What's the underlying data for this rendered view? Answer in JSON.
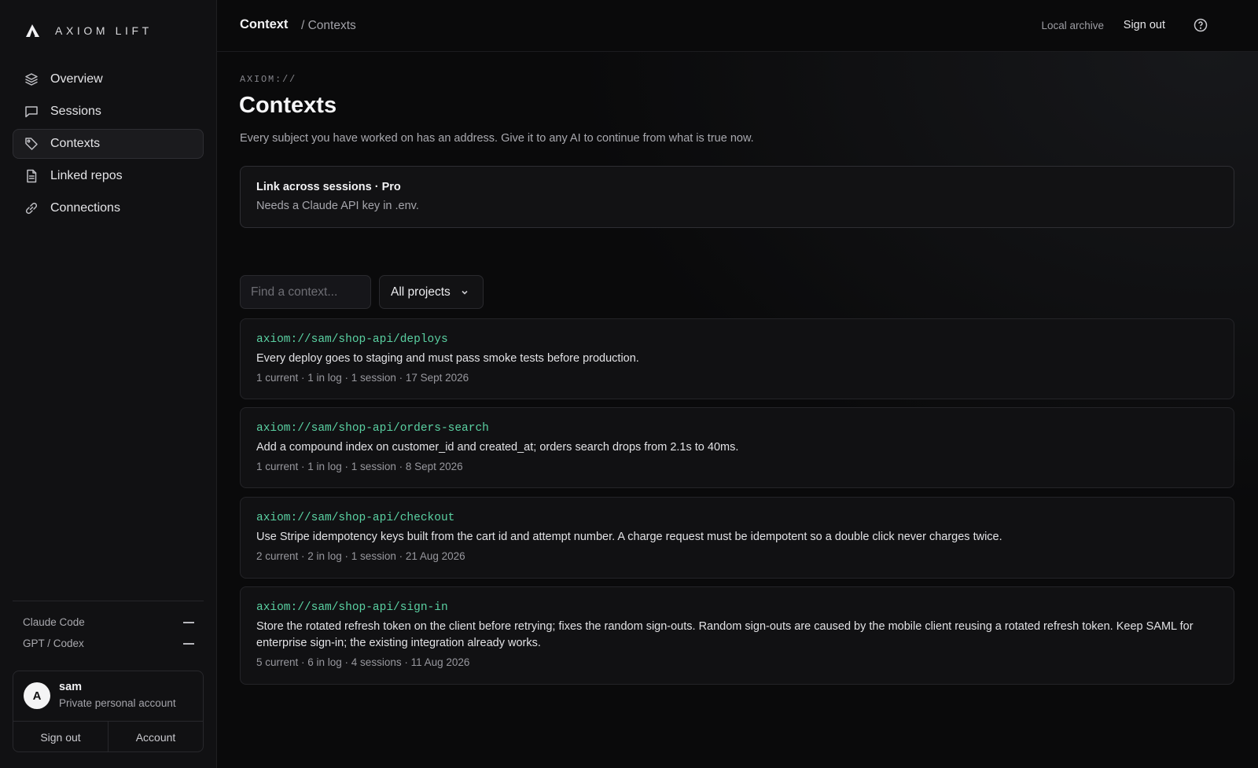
{
  "brand": {
    "name": "AXIOM LIFT"
  },
  "sidebar": {
    "items": [
      {
        "label": "Overview",
        "icon": "layers-icon"
      },
      {
        "label": "Sessions",
        "icon": "chat-icon"
      },
      {
        "label": "Contexts",
        "icon": "tag-icon",
        "active": true
      },
      {
        "label": "Linked repos",
        "icon": "document-icon"
      },
      {
        "label": "Connections",
        "icon": "link-icon"
      }
    ],
    "agents": [
      {
        "label": "Claude Code",
        "status": "—"
      },
      {
        "label": "GPT / Codex",
        "status": "—"
      }
    ],
    "account": {
      "initial": "A",
      "name": "sam",
      "subtitle": "Private personal account",
      "sign_out": "Sign out",
      "account": "Account"
    }
  },
  "topbar": {
    "crumb_main": "Context",
    "crumb_sub": "/ Contexts",
    "local_archive": "Local archive",
    "sign_out": "Sign out",
    "help_icon": "help-circle-icon"
  },
  "main": {
    "eyebrow": "AXIOM://",
    "title": "Contexts",
    "description": "Every subject you have worked on has an address. Give it to any AI to continue from what is true now.",
    "notice": {
      "title": "Link across sessions · Pro",
      "body": "Needs a Claude API key in .env."
    },
    "search": {
      "placeholder": "Find a context...",
      "value": ""
    },
    "project_filter": {
      "selected": "All projects"
    },
    "contexts": [
      {
        "address": "axiom://sam/shop-api/deploys",
        "text": "Every deploy goes to staging and must pass smoke tests before production.",
        "meta": "1 current · 1 in log · 1 session · 17 Sept 2026"
      },
      {
        "address": "axiom://sam/shop-api/orders-search",
        "text": "Add a compound index on customer_id and created_at; orders search drops from 2.1s to 40ms.",
        "meta": "1 current · 1 in log · 1 session · 8 Sept 2026"
      },
      {
        "address": "axiom://sam/shop-api/checkout",
        "text": "Use Stripe idempotency keys built from the cart id and attempt number. A charge request must be idempotent so a double click never charges twice.",
        "meta": "2 current · 2 in log · 1 session · 21 Aug 2026"
      },
      {
        "address": "axiom://sam/shop-api/sign-in",
        "text": "Store the rotated refresh token on the client before retrying; fixes the random sign-outs. Random sign-outs are caused by the mobile client reusing a rotated refresh token. Keep SAML for enterprise sign-in; the existing integration already works.",
        "meta": "5 current · 6 in log · 4 sessions · 11 Aug 2026"
      }
    ]
  },
  "colors": {
    "accent_green": "#5ad1a2",
    "background": "#0a0a0b",
    "sidebar": "#111113"
  }
}
